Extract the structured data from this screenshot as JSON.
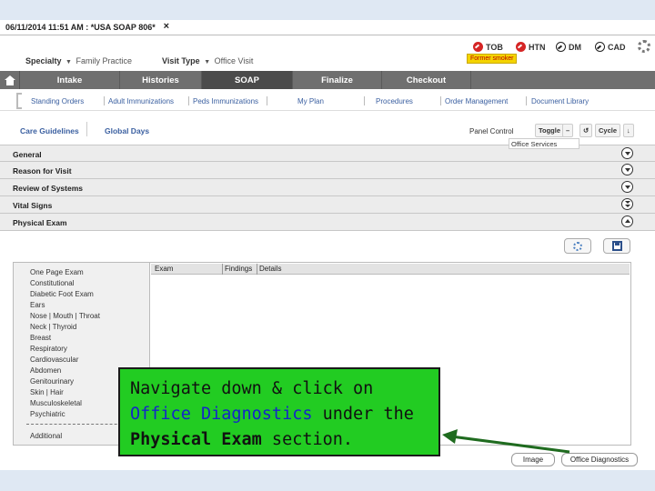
{
  "window": {
    "title": "06/11/2014 11:51 AM : *USA SOAP 806*",
    "close_glyph": "×",
    "corner_mark": "ʳ"
  },
  "encounter": {
    "specialty_label": "Specialty",
    "specialty_value": "Family Practice",
    "visit_type_label": "Visit Type",
    "visit_type_value": "Office Visit"
  },
  "flags": [
    {
      "label": "TOB",
      "icon": "red-no-sign-icon"
    },
    {
      "label": "HTN",
      "icon": "red-no-sign-icon"
    },
    {
      "label": "DM",
      "icon": "no-sign-icon"
    },
    {
      "label": "CAD",
      "icon": "no-sign-icon"
    }
  ],
  "former_smoker_badge": "Former smoker",
  "main_nav": {
    "tabs": [
      "Intake",
      "Histories",
      "SOAP",
      "Finalize",
      "Checkout"
    ],
    "active": "SOAP"
  },
  "sub_nav": [
    "Standing Orders",
    "Adult Immunizations",
    "Peds Immunizations",
    "My Plan",
    "Procedures",
    "Order Management",
    "Document Library"
  ],
  "toolbar": {
    "care_guidelines": "Care Guidelines",
    "global_days": "Global Days",
    "panel_control": "Panel Control",
    "toggle": "Toggle",
    "cycle": "Cycle",
    "minus_glyph": "–",
    "refresh_glyph": "↺",
    "expand_glyph": "↓",
    "tooltip": "Office Services"
  },
  "sections": [
    "General",
    "Reason for Visit",
    "Review of Systems",
    "Vital Signs",
    "Physical Exam"
  ],
  "physical_exam": {
    "list": [
      "One Page Exam",
      "Constitutional",
      "Diabetic Foot Exam",
      "Ears",
      "Nose | Mouth | Throat",
      "Neck | Thyroid",
      "Breast",
      "Respiratory",
      "Cardiovascular",
      "Abdomen",
      "Genitourinary",
      "Skin | Hair",
      "Musculoskeletal",
      "Psychiatric"
    ],
    "additional": "Additional",
    "columns": [
      "Exam",
      "Findings",
      "Details"
    ]
  },
  "buttons": {
    "image": "Image",
    "office_diagnostics": "Office Diagnostics"
  },
  "callout": {
    "line1": "Navigate down & click on",
    "line2_highlight": "Office Diagnostics",
    "line2_rest": " under the",
    "line3_bold": "Physical Exam",
    "line3_rest": " section."
  },
  "colors": {
    "nav_bg": "#6f6f6f",
    "nav_active": "#4b4b4b",
    "link": "#3a5fa0",
    "callout_bg": "#22cc22",
    "callout_highlight": "#1525c9",
    "arrow": "#1f6b1f"
  }
}
